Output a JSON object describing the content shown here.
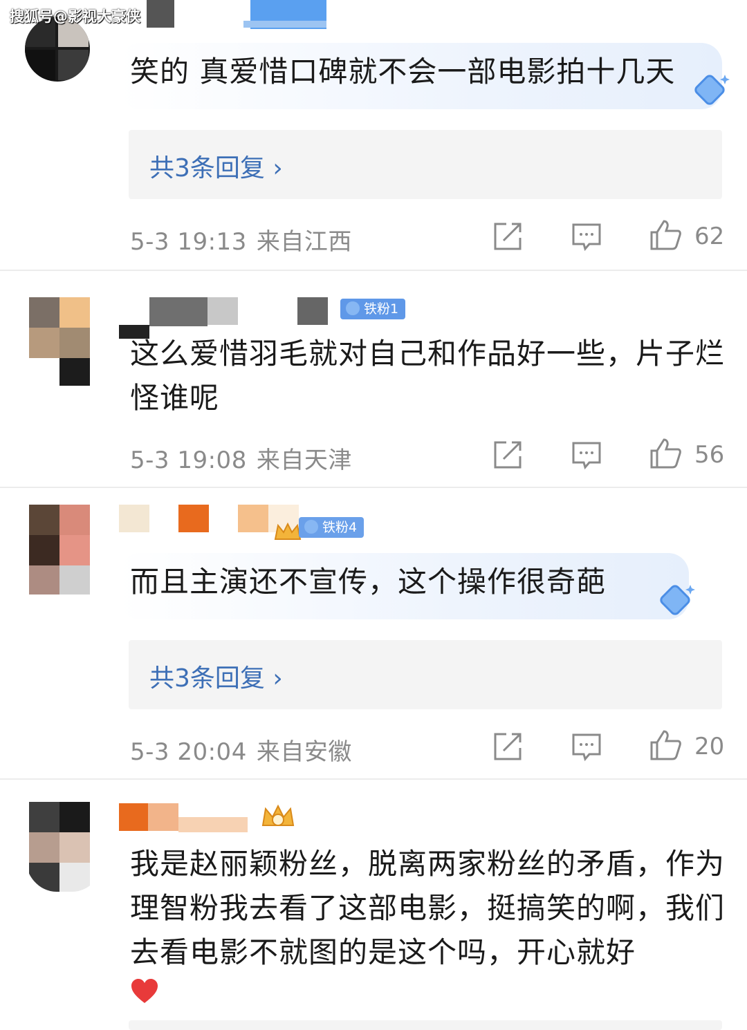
{
  "watermark": "搜狐号@影视大豪侠",
  "comments": [
    {
      "name": "",
      "text": "笑的 真爱惜口碑就不会一部电影拍十几天",
      "replies_label": "共3条回复 ›",
      "time": "5-3 19:13",
      "location": "来自江西",
      "likes": "62"
    },
    {
      "name": "",
      "badge": "铁粉1",
      "text": "这么爱惜羽毛就对自己和作品好一些，片子烂怪谁呢",
      "time": "5-3 19:08",
      "location": "来自天津",
      "likes": "56"
    },
    {
      "name": "",
      "badge": "铁粉4",
      "text": "而且主演还不宣传，这个操作很奇葩",
      "replies_label": "共3条回复 ›",
      "time": "5-3 20:04",
      "location": "来自安徽",
      "likes": "20"
    },
    {
      "name": "",
      "text": "我是赵丽颖粉丝，脱离两家粉丝的矛盾，作为理智粉我去看了这部电影，挺搞笑的啊，我们去看电影不就图的是这个吗，开心就好"
    }
  ],
  "icons": [
    "share-icon",
    "comment-icon",
    "like-icon",
    "heart-icon",
    "diamond-icon",
    "crown-icon"
  ],
  "colors": {
    "link": "#3d6fb6",
    "meta": "#8a8a8a",
    "badge": "#5f98e8",
    "heart": "#e83a3a"
  }
}
